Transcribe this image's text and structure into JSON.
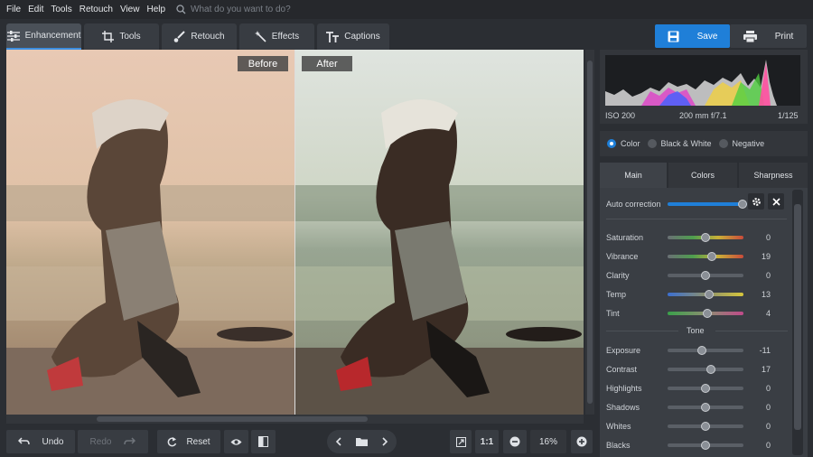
{
  "menu": [
    "File",
    "Edit",
    "Tools",
    "Retouch",
    "View",
    "Help"
  ],
  "search": {
    "placeholder": "What do you want to do?"
  },
  "tabs": [
    {
      "label": "Enhancement",
      "icon": "sliders-icon",
      "active": true
    },
    {
      "label": "Tools",
      "icon": "crop-icon",
      "active": false
    },
    {
      "label": "Retouch",
      "icon": "brush-icon",
      "active": false
    },
    {
      "label": "Effects",
      "icon": "magic-wand-icon",
      "active": false
    },
    {
      "label": "Captions",
      "icon": "text-icon",
      "active": false
    }
  ],
  "actions": {
    "save": "Save",
    "print": "Print"
  },
  "viewer": {
    "before": "Before",
    "after": "After"
  },
  "bottom": {
    "undo": "Undo",
    "redo": "Redo",
    "reset": "Reset",
    "ratio": "1:1",
    "zoom": "16%"
  },
  "histogram": {
    "iso": "ISO 200",
    "lens": "200 mm f/7.1",
    "shutter": "1/125"
  },
  "modes": [
    {
      "label": "Color",
      "selected": true
    },
    {
      "label": "Black & White",
      "selected": false
    },
    {
      "label": "Negative",
      "selected": false
    }
  ],
  "panel_tabs": [
    {
      "label": "Main",
      "active": true
    },
    {
      "label": "Colors",
      "active": false
    },
    {
      "label": "Sharpness",
      "active": false
    }
  ],
  "auto_correction": {
    "label": "Auto correction",
    "level": 1.0
  },
  "color_sliders": [
    {
      "label": "Saturation",
      "value": "0",
      "level": 0.5
    },
    {
      "label": "Vibrance",
      "value": "19",
      "level": 0.58
    },
    {
      "label": "Clarity",
      "value": "0",
      "level": 0.5
    },
    {
      "label": "Temp",
      "value": "13",
      "level": 0.55
    },
    {
      "label": "Tint",
      "value": "4",
      "level": 0.52
    }
  ],
  "tone": {
    "heading": "Tone",
    "sliders": [
      {
        "label": "Exposure",
        "value": "-11",
        "level": 0.45
      },
      {
        "label": "Contrast",
        "value": "17",
        "level": 0.57
      },
      {
        "label": "Highlights",
        "value": "0",
        "level": 0.5
      },
      {
        "label": "Shadows",
        "value": "0",
        "level": 0.5
      },
      {
        "label": "Whites",
        "value": "0",
        "level": 0.5
      },
      {
        "label": "Blacks",
        "value": "0",
        "level": 0.5
      }
    ]
  }
}
